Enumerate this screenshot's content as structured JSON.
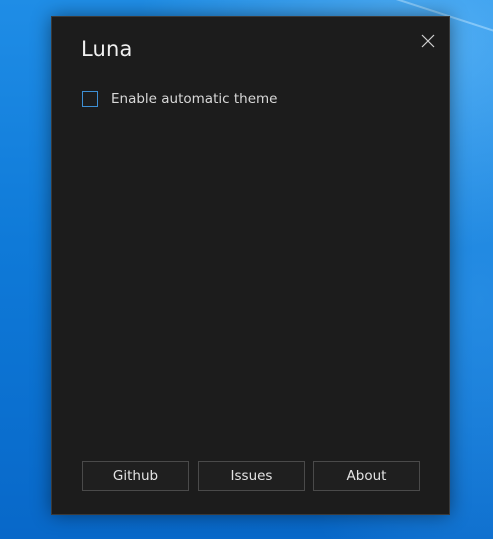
{
  "window": {
    "title": "Luna",
    "close_icon": "close-icon"
  },
  "settings": {
    "auto_theme_label": "Enable automatic theme",
    "auto_theme_checked": false
  },
  "footer": {
    "github_label": "Github",
    "issues_label": "Issues",
    "about_label": "About"
  },
  "colors": {
    "window_background": "#1c1c1c",
    "checkbox_border": "#3d8fd4",
    "desktop_background": "#0f7ad8"
  }
}
